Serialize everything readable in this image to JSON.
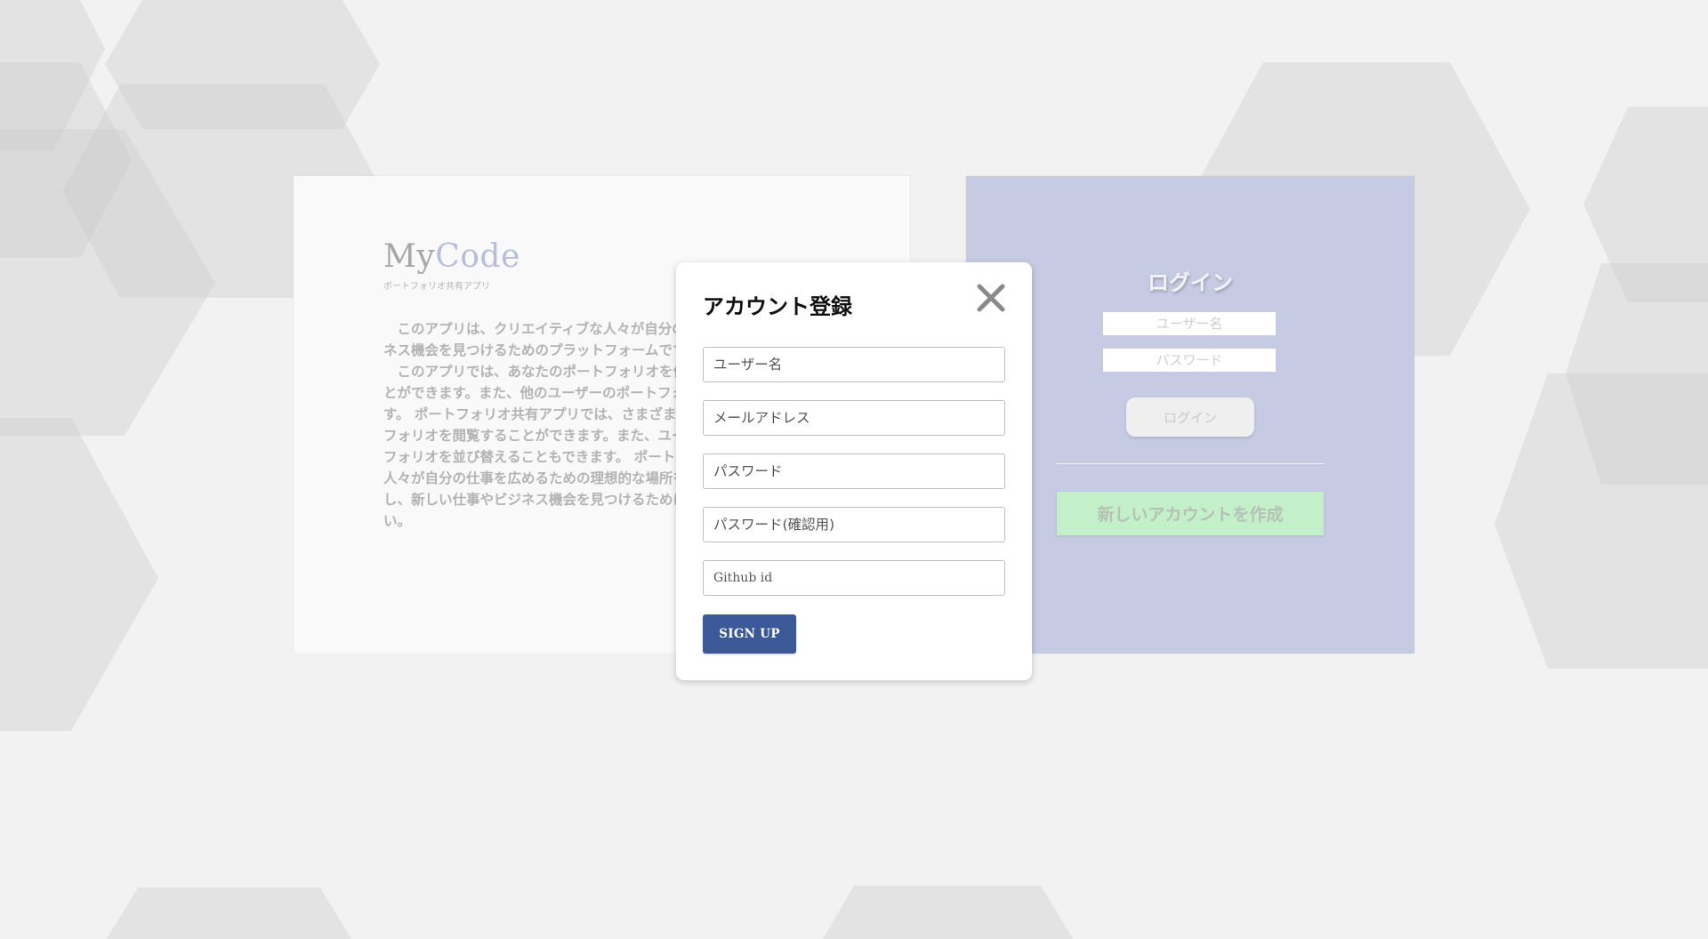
{
  "app": {
    "logo_part1": "My",
    "logo_part2": "Code",
    "logo_subtitle": "ポートフォリオ共有アプリ",
    "description": [
      "このアプリは、クリエイティブな人々が自分の作品を共有し、新しい仕事やビジネス機会を見つけるためのプラットフォームです。",
      "このアプリでは、あなたのポートフォリオを作成し、他のユーザーに公開することができます。また、他のユーザーのポートフォリオを閲覧し、いいねを押せます。 ポートフォリオ共有アプリでは、さまざまなカテゴリーに分類されたポートフォリオを閲覧することができます。また、ユーザーの評価やいいねの数でポートフォリオを並び替えることもできます。 ポートフォリオ共有アプリは、創造的な人々が自分の仕事を広めるための理想的な場所を提供します。あなたの作品を共有し、新しい仕事やビジネス機会を見つけるために、ぜひこのアプリをご利用ください。"
    ]
  },
  "login": {
    "title": "ログイン",
    "username_placeholder": "ユーザー名",
    "password_placeholder": "パスワード",
    "login_button": "ログイン",
    "create_account_button": "新しいアカウントを作成"
  },
  "modal": {
    "title": "アカウント登録",
    "close_icon": "close-icon",
    "fields": {
      "username": "ユーザー名",
      "email": "メールアドレス",
      "password": "パスワード",
      "password_confirm": "パスワード(確認用)",
      "github": "Github id"
    },
    "submit_label": "SIGN UP"
  },
  "colors": {
    "background": "#f2f2f2",
    "login_panel": "#c6cbe3",
    "create_button": "#c3f0c8",
    "signup_button": "#3b5998",
    "logo_accent": "#b7bedc"
  }
}
